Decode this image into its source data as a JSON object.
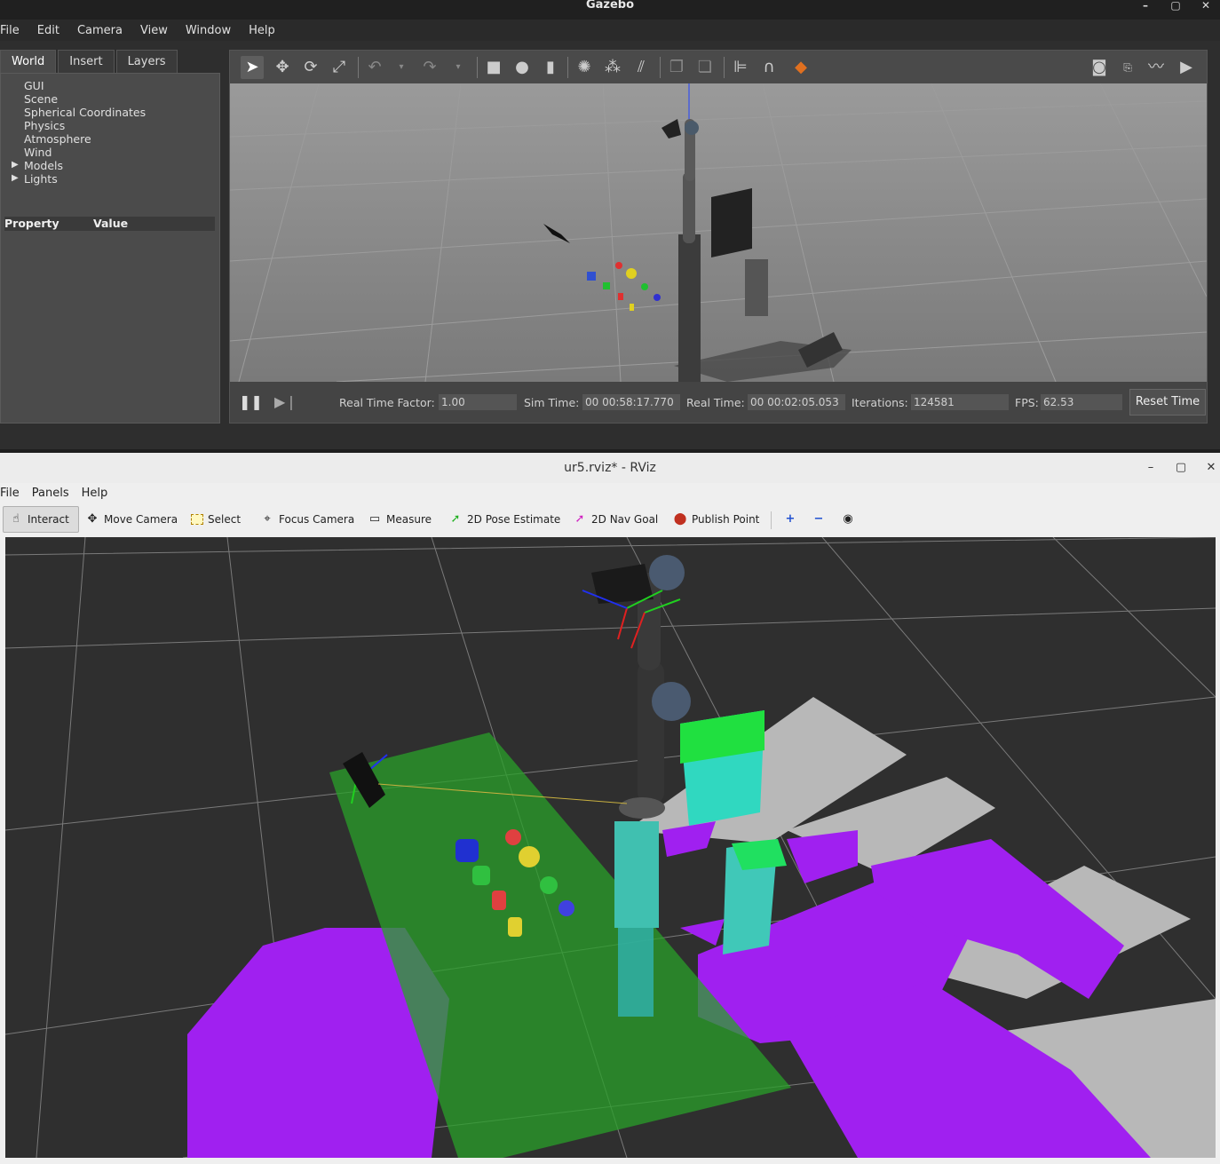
{
  "gazebo": {
    "title": "Gazebo",
    "menu": [
      "File",
      "Edit",
      "Camera",
      "View",
      "Window",
      "Help"
    ],
    "tabs": [
      "World",
      "Insert",
      "Layers"
    ],
    "world_tree": [
      "GUI",
      "Scene",
      "Spherical Coordinates",
      "Physics",
      "Atmosphere",
      "Wind",
      "Models",
      "Lights"
    ],
    "property_header": {
      "property": "Property",
      "value": "Value"
    },
    "status": {
      "rtf_label": "Real Time Factor:",
      "rtf_value": "1.00",
      "sim_label": "Sim Time:",
      "sim_value": "00 00:58:17.770",
      "real_label": "Real Time:",
      "real_value": "00 00:02:05.053",
      "iter_label": "Iterations:",
      "iter_value": "124581",
      "fps_label": "FPS:",
      "fps_value": "62.53",
      "reset_label": "Reset Time"
    },
    "win_controls": [
      "–",
      "▢",
      "✕"
    ]
  },
  "rviz": {
    "title": "ur5.rviz* - RViz",
    "menu": [
      "File",
      "Panels",
      "Help"
    ],
    "tools": [
      "Interact",
      "Move Camera",
      "Select",
      "Focus Camera",
      "Measure",
      "2D Pose Estimate",
      "2D Nav Goal",
      "Publish Point"
    ],
    "win_controls": [
      "–",
      "▢",
      "✕"
    ]
  },
  "colors": {
    "occupancy_magenta": "#a020f0",
    "table_green": "#2aa02a",
    "free_space_gray": "#b4b4b4",
    "grid_line": "#7a7a7a"
  }
}
